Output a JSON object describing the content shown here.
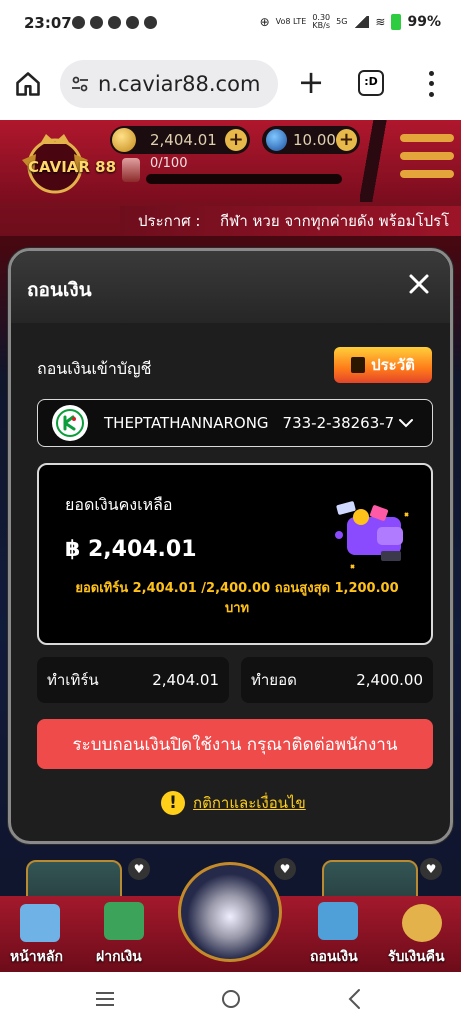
{
  "status_bar": {
    "time": "23:07",
    "net_speed": "0.30",
    "net_unit": "KB/s",
    "volte": "Vo8 LTE",
    "signal": "5G",
    "battery": "99%"
  },
  "browser": {
    "url": "n.caviar88.com",
    "tabs_label": ":D"
  },
  "site_header": {
    "logo_text": "CAVIAR 88",
    "coin_balance": "2,404.01",
    "gem_balance": "10.00",
    "level_progress": "0/100",
    "announce_label": "ประกาศ :",
    "announce_text": "กีฬา หวย จากทุกค่ายดัง พร้อมโปรโ"
  },
  "modal": {
    "title": "ถอนเงิน",
    "account_label": "ถอนเงินเข้าบัญชี",
    "history_label": "ประวัติ",
    "bank_name": "THEPTATHANNARONG",
    "bank_number": "733-2-38263-7",
    "balance_title": "ยอดเงินคงเหลือ",
    "balance_amount": "฿ 2,404.01",
    "turnover_note": "ยอดเทิร์น 2,404.01 /2,400.00 ถอนสูงสุด 1,200.00 บาท",
    "turn_label": "ทำเทิร์น",
    "turn_value": "2,404.01",
    "target_label": "ทำยอด",
    "target_value": "2,400.00",
    "disabled_message": "ระบบถอนเงินปิดใช้งาน กรุณาติดต่อพนักงาน",
    "terms_label": "กติกาและเงื่อนไข"
  },
  "bottom_nav": {
    "items": [
      {
        "label": "หน้าหลัก",
        "icon": "house-icon"
      },
      {
        "label": "ฝากเงิน",
        "icon": "deposit-icon"
      },
      {
        "label": "ถอนเงิน",
        "icon": "withdraw-icon"
      },
      {
        "label": "รับเงินคืน",
        "icon": "cashback-icon"
      }
    ]
  },
  "colors": {
    "accent_red": "#ef4b4b",
    "gold": "#ffc21a",
    "header_red": "#b0172d"
  }
}
